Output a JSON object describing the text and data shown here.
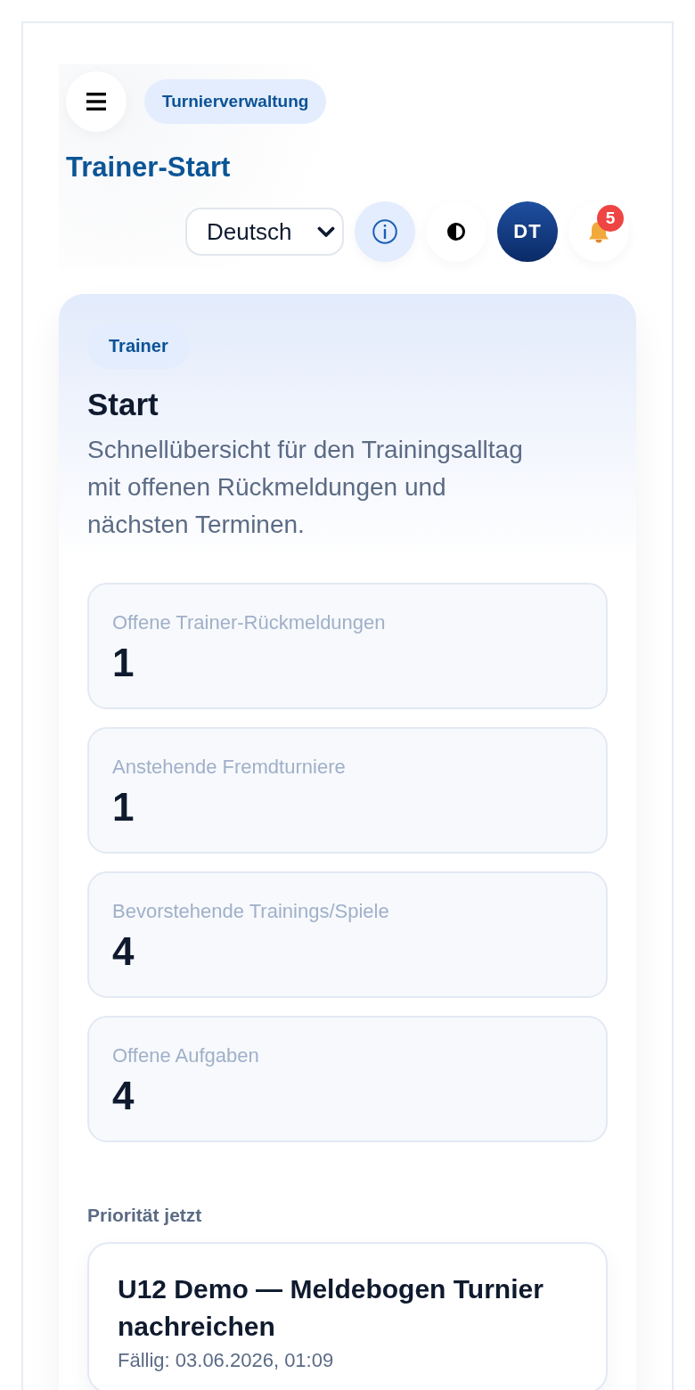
{
  "header": {
    "app_badge": "Turnierverwaltung",
    "title": "Trainer-Start",
    "language": {
      "value": "Deutsch"
    },
    "avatar": {
      "initials": "DT"
    },
    "notifications": {
      "count": "5"
    }
  },
  "hero": {
    "tag": "Trainer",
    "title": "Start",
    "description": "Schnellübersicht für den Trainingsalltag mit offenen Rückmeldungen und nächsten Terminen."
  },
  "stats": [
    {
      "label": "Offene Trainer-Rückmeldungen",
      "value": "1"
    },
    {
      "label": "Anstehende Fremdturniere",
      "value": "1"
    },
    {
      "label": "Bevorstehende Trainings/Spiele",
      "value": "4"
    },
    {
      "label": "Offene Aufgaben",
      "value": "4"
    }
  ],
  "priority": {
    "heading": "Priorität jetzt",
    "items": [
      {
        "title": "U12 Demo — Meldebogen Turnier nachreichen",
        "due": "Fällig: 03.06.2026, 01:09"
      }
    ]
  }
}
